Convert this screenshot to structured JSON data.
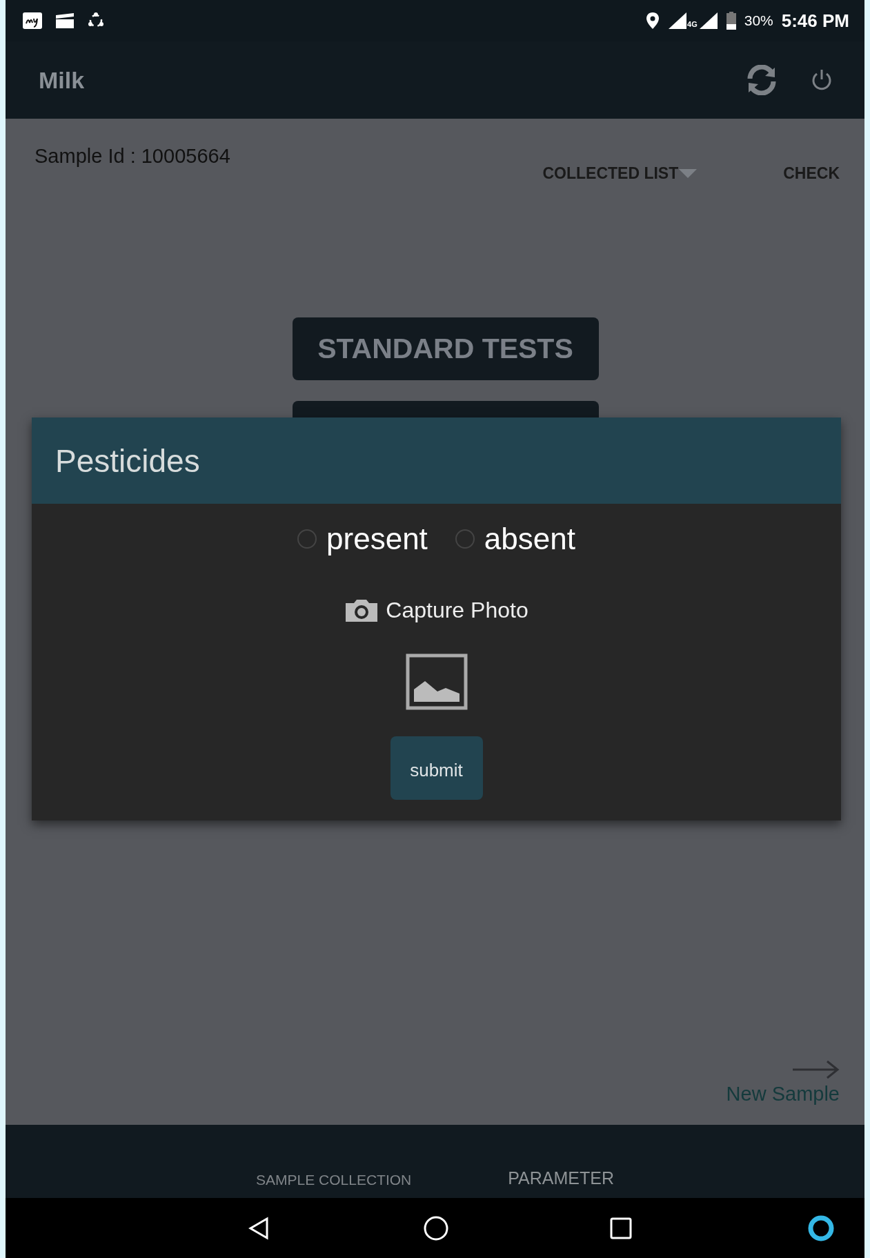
{
  "status_bar": {
    "network": "4G",
    "battery": "30%",
    "time": "5:46 PM"
  },
  "app_bar": {
    "title": "Milk"
  },
  "sample": {
    "id_label": "Sample Id : 10005664",
    "menu": "COLLECTED LIST",
    "check": "CHECK",
    "test_button": "STANDARD TESTS"
  },
  "dialog": {
    "title": "Pesticides",
    "options": [
      {
        "label": "present",
        "selected": false
      },
      {
        "label": "absent",
        "selected": false
      }
    ],
    "capture": "Capture Photo",
    "submit": "submit"
  },
  "new_sample": "New Sample",
  "tabs": [
    {
      "label": "SAMPLE COLLECTION",
      "selected": false
    },
    {
      "label": "PARAMETER",
      "selected": true
    }
  ]
}
